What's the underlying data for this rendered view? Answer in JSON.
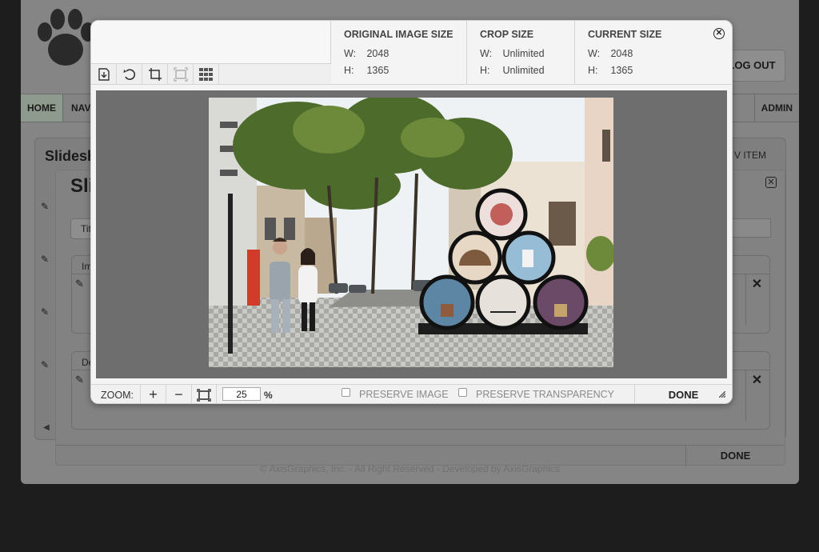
{
  "background_app": {
    "logout_label": "LOG OUT",
    "nav": {
      "home": "HOME",
      "second": "NAV",
      "admin": "ADMIN"
    },
    "panel_title": "Slidesh",
    "new_item_label": "V ITEM",
    "footer": "© AxisGraphics, Inc. - All Right Reserved - Developed by AxisGraphics"
  },
  "slideshow_dialog": {
    "title": "Sli",
    "tab_label": "Tit",
    "image_section_label": "Im",
    "desc_section_label": "De",
    "done_label": "DONE"
  },
  "crop_dialog": {
    "original": {
      "title": "ORIGINAL IMAGE SIZE",
      "w_label": "W:",
      "w": "2048",
      "h_label": "H:",
      "h": "1365"
    },
    "crop": {
      "title": "CROP SIZE",
      "w_label": "W:",
      "w": "Unlimited",
      "h_label": "H:",
      "h": "Unlimited"
    },
    "current": {
      "title": "CURRENT SIZE",
      "w_label": "W:",
      "w": "2048",
      "h_label": "H:",
      "h": "1365"
    },
    "zoom_label": "ZOOM:",
    "zoom_value": "25",
    "zoom_unit": "%",
    "preserve_image_label": "PRESERVE IMAGE",
    "preserve_transparency_label": "PRESERVE TRANSPARENCY",
    "preserve_image_checked": false,
    "preserve_transparency_checked": false,
    "done_label": "DONE"
  },
  "icons": [
    "paw-logo-icon",
    "save-icon",
    "rotate-icon",
    "crop-icon",
    "fit-icon",
    "grid-icon",
    "close-icon",
    "zoom-in-icon",
    "zoom-out-icon",
    "zoom-fit-icon",
    "edit-icon",
    "resize-grip-icon"
  ],
  "colors": {
    "canvas": "#6e6e6e",
    "dialog": "#f4f4f4",
    "overlay_page": "#858585",
    "body": "#1d1d1d"
  }
}
